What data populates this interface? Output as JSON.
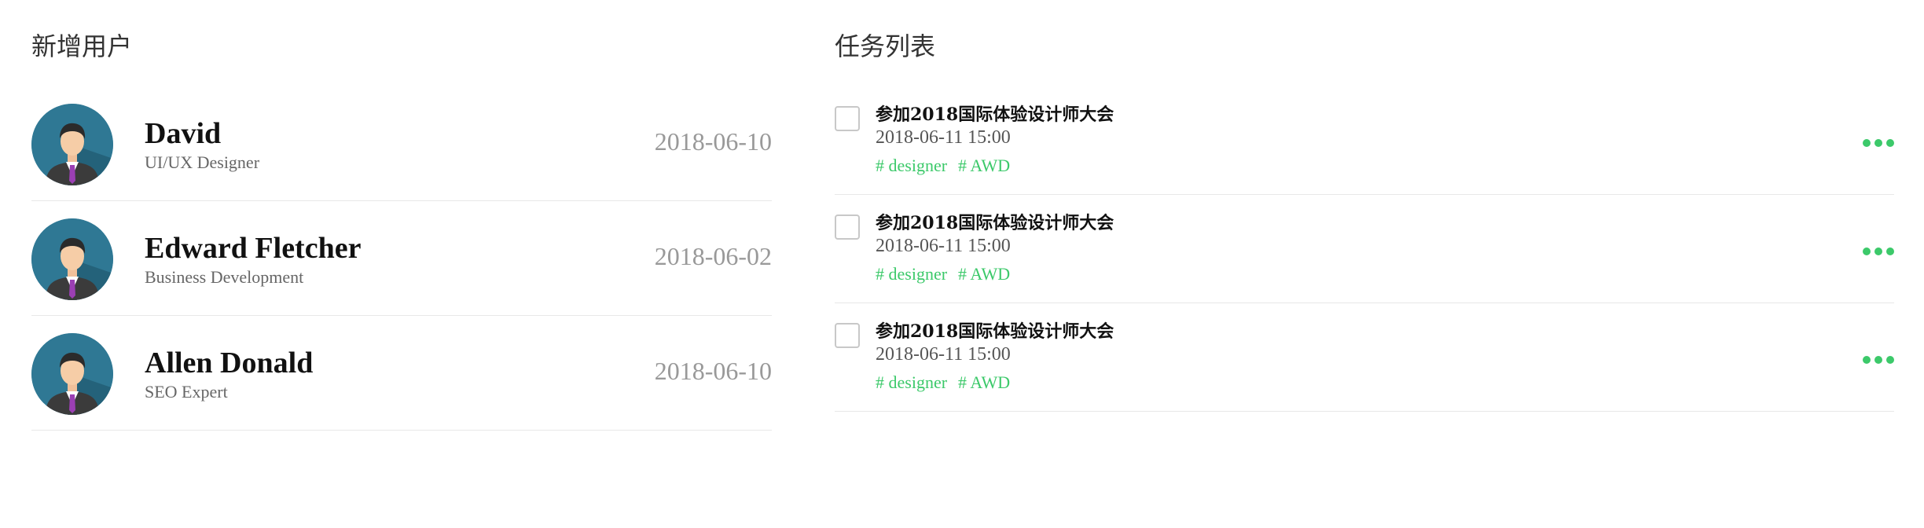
{
  "users": {
    "title": "新增用户",
    "items": [
      {
        "name": "David",
        "role": "UI/UX Designer",
        "date": "2018-06-10"
      },
      {
        "name": "Edward Fletcher",
        "role": "Business Development",
        "date": "2018-06-02"
      },
      {
        "name": "Allen Donald",
        "role": "SEO Expert",
        "date": "2018-06-10"
      }
    ]
  },
  "tasks": {
    "title": "任务列表",
    "items": [
      {
        "title": "参加2018国际体验设计师大会",
        "time": "2018-06-11 15:00",
        "tags": [
          "# designer",
          "# AWD"
        ]
      },
      {
        "title": "参加2018国际体验设计师大会",
        "time": "2018-06-11 15:00",
        "tags": [
          "# designer",
          "# AWD"
        ]
      },
      {
        "title": "参加2018国际体验设计师大会",
        "time": "2018-06-11 15:00",
        "tags": [
          "# designer",
          "# AWD"
        ]
      }
    ]
  },
  "colors": {
    "accent": "#3cc96a",
    "avatar_bg": "#2f7894",
    "divider": "#e8e8e8"
  },
  "icons": {
    "avatar": "user-avatar-icon",
    "more": "more-dots-icon",
    "checkbox": "checkbox-icon"
  }
}
